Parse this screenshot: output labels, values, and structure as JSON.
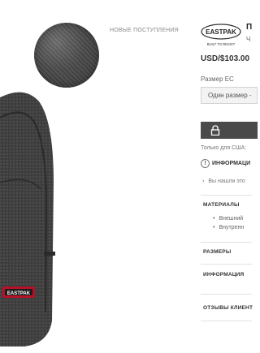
{
  "header": {
    "new_arrivals": "НОВЫЕ ПОСТУПЛЕНИЯ"
  },
  "brand": {
    "logo_text": "EASTPAK",
    "tagline": "BUILT TO RESIST"
  },
  "product": {
    "title": "П",
    "subtitle": "Ч",
    "price": "USD/$103.00",
    "badge": "EASTPAK",
    "icon": "backpack-photo",
    "swatch_icon": "color-swatch-icon"
  },
  "size": {
    "label": "Размер ЕС",
    "selected": "Один размер -"
  },
  "actions": {
    "add_icon": "lock-icon"
  },
  "notices": {
    "us_only": "Только для США:",
    "info_heading": "ИНФОРМАЦИ",
    "info_icon": "info-icon",
    "found_text": "Вы нашли это",
    "found_icon": "chevron-right-icon"
  },
  "sections": {
    "materials": "МАТЕРИАЛЫ",
    "materials_items": [
      "Внешний",
      "Внутренн"
    ],
    "sizes": "РАЗМЕРЫ",
    "information": "ИНФОРМАЦИЯ",
    "reviews": "ОТЗЫВЫ КЛИЕНТ"
  },
  "colors": {
    "button_bg": "#4a4a4a",
    "backpack": "#3e3e3e"
  }
}
